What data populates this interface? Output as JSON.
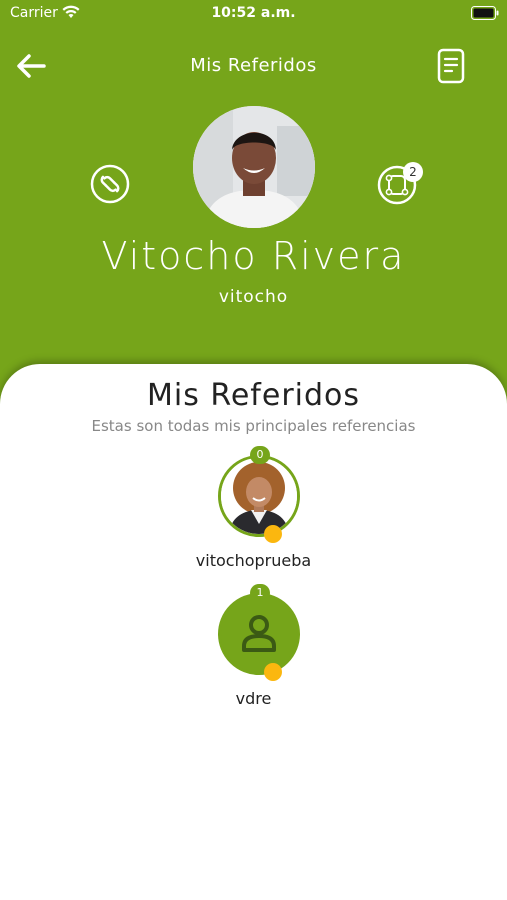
{
  "status_bar": {
    "carrier": "Carrier",
    "time": "10:52 a.m."
  },
  "nav": {
    "title": "Mis Referidos"
  },
  "profile": {
    "name": "Vitocho Rivera",
    "username": "vitocho",
    "tree_badge_count": "2"
  },
  "card": {
    "title": "Mis Referidos",
    "subtitle": "Estas son todas mis principales referencias"
  },
  "referrals": [
    {
      "username": "vitochoprueba",
      "count": "0"
    },
    {
      "username": "vdre",
      "count": "1"
    }
  ],
  "colors": {
    "brand_green": "#76a51a",
    "status_dot": "#fbb70f",
    "dark_green": "#3b5a14"
  }
}
